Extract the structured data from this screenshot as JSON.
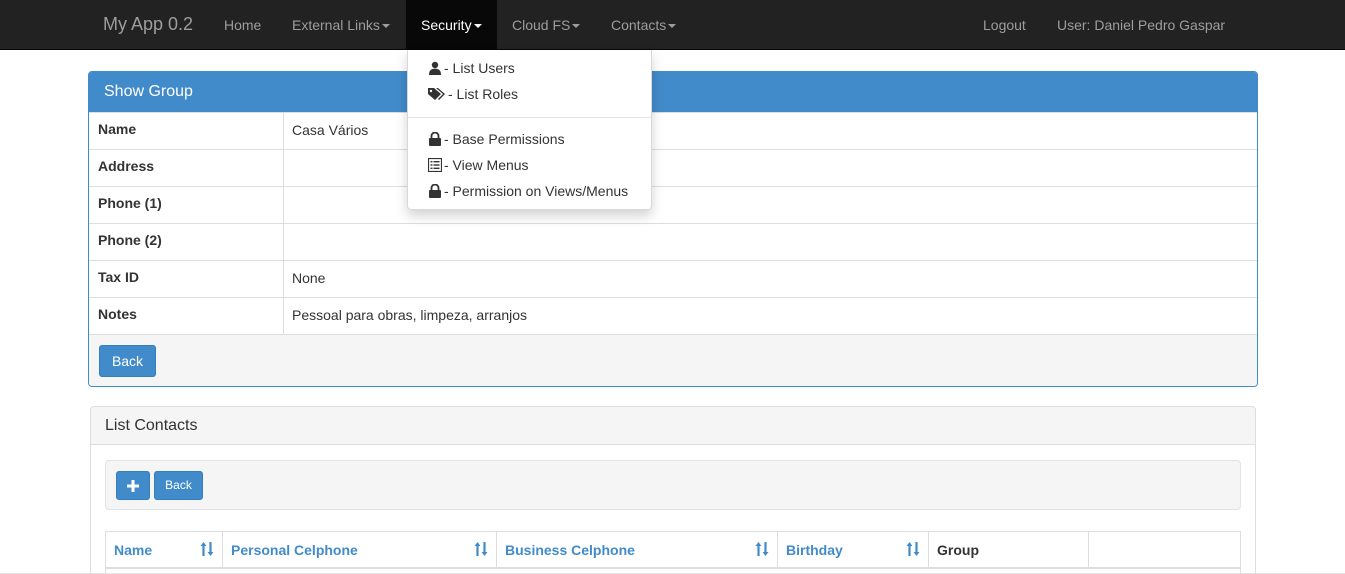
{
  "navbar": {
    "brand": "My App 0.2",
    "items": [
      {
        "label": "Home"
      },
      {
        "label": "External Links"
      },
      {
        "label": "Security"
      },
      {
        "label": "Cloud FS"
      },
      {
        "label": "Contacts"
      }
    ],
    "logout": "Logout",
    "user": "User: Daniel Pedro Gaspar"
  },
  "security_menu": {
    "items": [
      {
        "label": "- List Users",
        "icon": "user-icon"
      },
      {
        "label": "- List Roles",
        "icon": "tags-icon"
      },
      {
        "label": "- Base Permissions",
        "icon": "lock-icon"
      },
      {
        "label": "- View Menus",
        "icon": "list-alt-icon"
      },
      {
        "label": "- Permission on Views/Menus",
        "icon": "lock-icon"
      }
    ]
  },
  "show_group": {
    "title": "Show Group",
    "fields": [
      {
        "label": "Name",
        "value": "Casa Vários"
      },
      {
        "label": "Address",
        "value": ""
      },
      {
        "label": "Phone (1)",
        "value": ""
      },
      {
        "label": "Phone (2)",
        "value": ""
      },
      {
        "label": "Tax ID",
        "value": "None"
      },
      {
        "label": "Notes",
        "value": "Pessoal para obras, limpeza, arranjos"
      }
    ],
    "back_label": "Back"
  },
  "list_contacts": {
    "title": "List Contacts",
    "add_icon": "plus-icon",
    "back_label": "Back",
    "columns": [
      {
        "label": "Name",
        "sortable": true
      },
      {
        "label": "Personal Celphone",
        "sortable": true
      },
      {
        "label": "Business Celphone",
        "sortable": true
      },
      {
        "label": "Birthday",
        "sortable": true
      },
      {
        "label": "Group",
        "sortable": false
      },
      {
        "label": "",
        "sortable": false
      }
    ]
  },
  "colors": {
    "primary": "#428bca",
    "navbar_bg": "#222222",
    "navbar_text": "#9d9d9d",
    "active_bg": "#080808"
  }
}
